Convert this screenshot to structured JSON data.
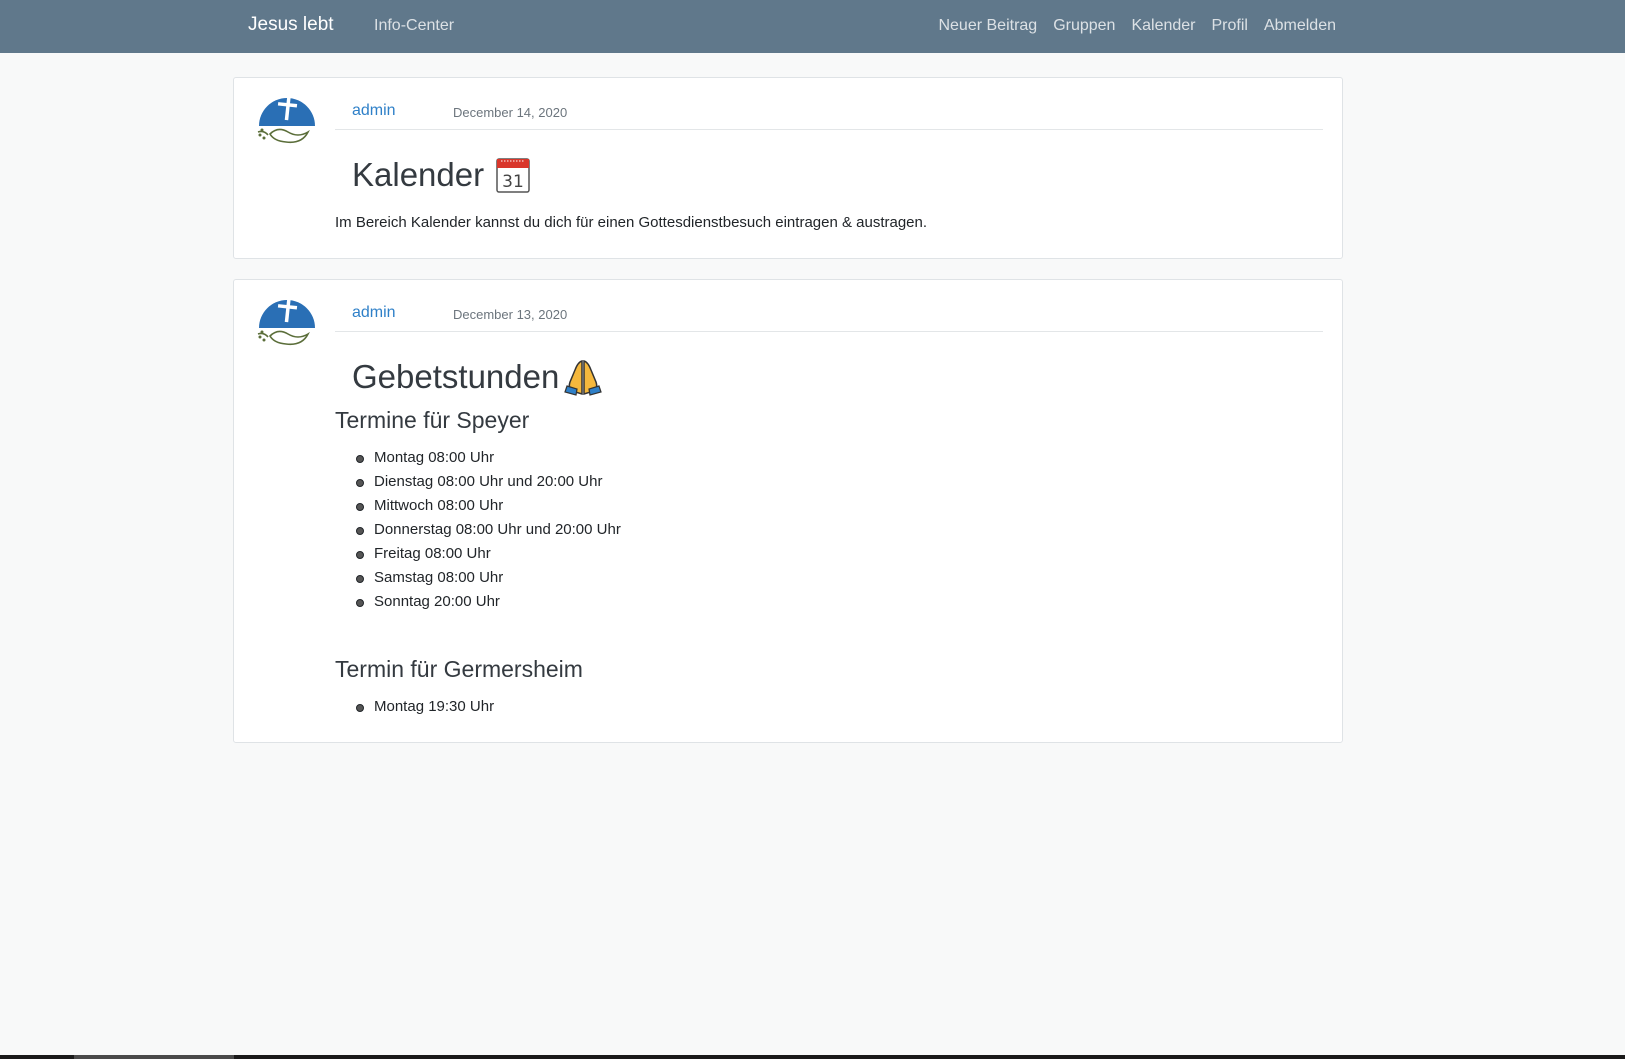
{
  "navbar": {
    "brand": "Jesus lebt",
    "left_link": "Info-Center",
    "right_links": [
      "Neuer Beitrag",
      "Gruppen",
      "Kalender",
      "Profil",
      "Abmelden"
    ]
  },
  "posts": [
    {
      "author": "admin",
      "date": "December 14, 2020",
      "title": "Kalender",
      "title_icon": "calendar-icon",
      "calendar_day": "31",
      "body": "Im Bereich Kalender kannst du dich für einen Gottesdienstbesuch eintragen & austragen."
    },
    {
      "author": "admin",
      "date": "December 13, 2020",
      "title": "Gebetstunden",
      "title_icon": "praying-hands-icon",
      "sections": [
        {
          "heading": "Termine für Speyer",
          "items": [
            "Montag 08:00 Uhr",
            "Dienstag 08:00 Uhr und 20:00 Uhr",
            "Mittwoch 08:00 Uhr",
            "Donnerstag 08:00 Uhr und 20:00 Uhr",
            "Freitag 08:00 Uhr",
            "Samstag 08:00 Uhr",
            "Sonntag 20:00 Uhr"
          ]
        },
        {
          "heading": "Termin für Germersheim",
          "items": [
            "Montag 19:30 Uhr"
          ]
        }
      ]
    }
  ],
  "colors": {
    "navbar": "#60788b",
    "link": "#2f80c8",
    "background": "#f8f9f9"
  }
}
